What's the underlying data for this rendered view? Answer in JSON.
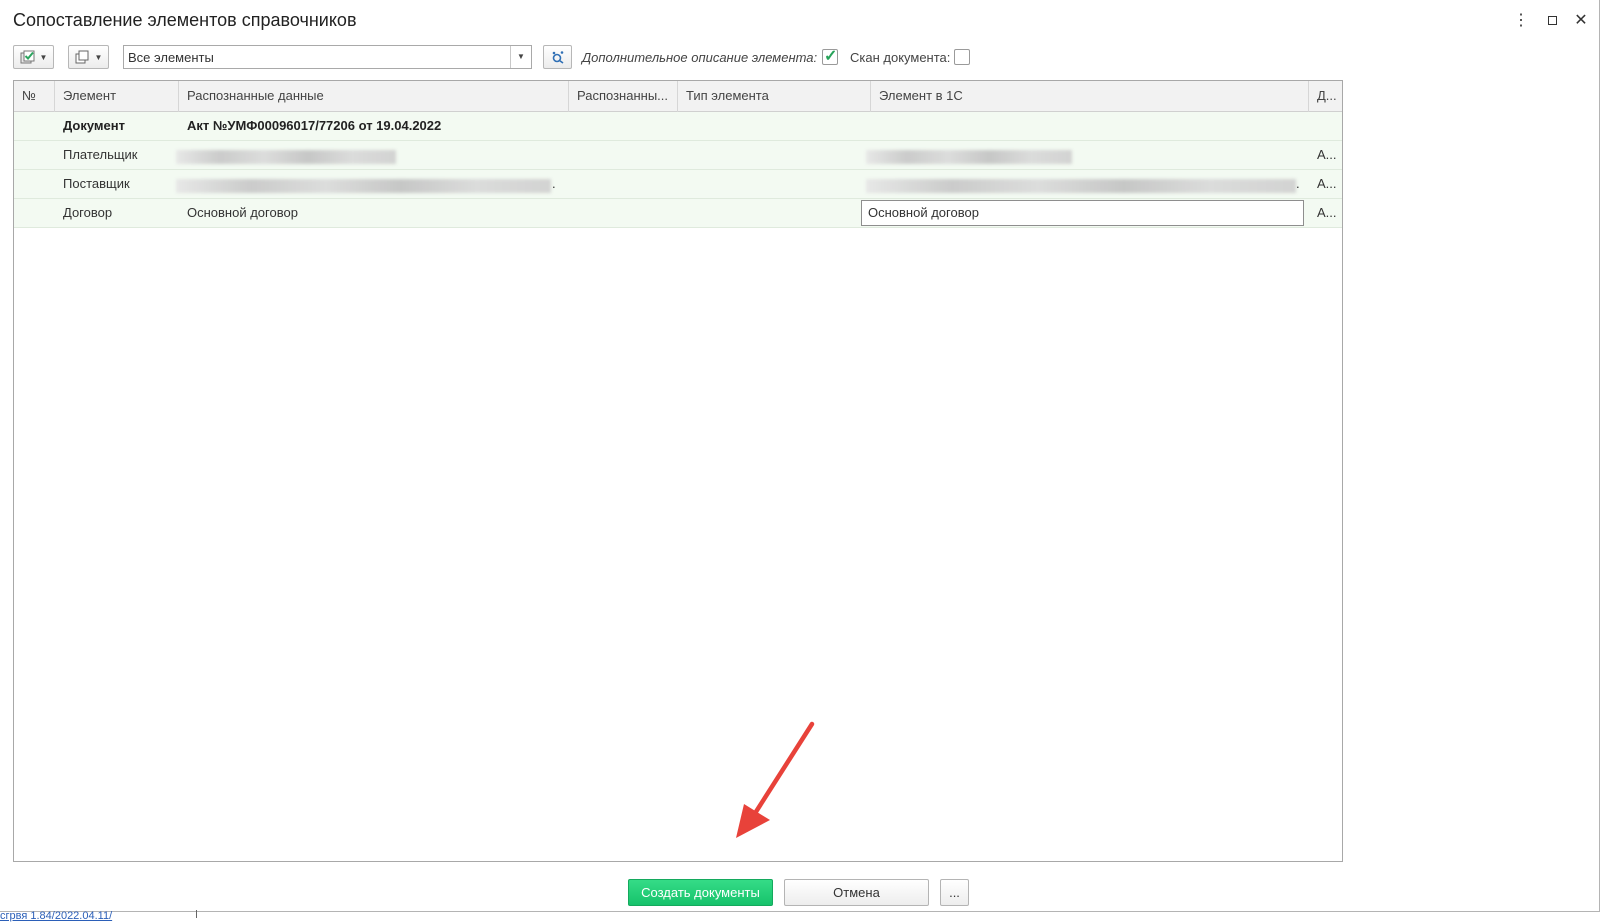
{
  "window": {
    "title": "Сопоставление элементов справочников",
    "menu_icon": "⋮",
    "close_icon": "✕"
  },
  "toolbar": {
    "filter_value": "Все элементы",
    "extra_desc_label": "Дополнительное описание элемента:",
    "extra_desc_checked": true,
    "scan_label": "Скан документа:",
    "scan_checked": false
  },
  "table": {
    "columns": [
      "№",
      "Элемент",
      "Распознанные данные",
      "Распознанны...",
      "Тип элемента",
      "Элемент в 1С",
      "Д..."
    ],
    "rows": [
      {
        "element": "Документ",
        "recognized": "Акт №УМФ00096017/77206 от 19.04.2022",
        "element_1c": "",
        "d": ""
      },
      {
        "element": "Плательщик",
        "recognized": "",
        "element_1c": "",
        "d": "А..."
      },
      {
        "element": "Поставщик",
        "recognized": ".",
        "element_1c": ".",
        "d": "А..."
      },
      {
        "element": "Договор",
        "recognized": "Основной договор",
        "element_1c": "Основной договор",
        "d": "А..."
      }
    ]
  },
  "footer": {
    "create_label": "Создать документы",
    "cancel_label": "Отмена",
    "more_label": "...",
    "status_link": "сгрвя 1.84/2022.04.11/"
  },
  "colors": {
    "accent_green": "#1fcf78",
    "row_bg": "#f3faf2",
    "annotation_arrow": "#e8423a"
  }
}
